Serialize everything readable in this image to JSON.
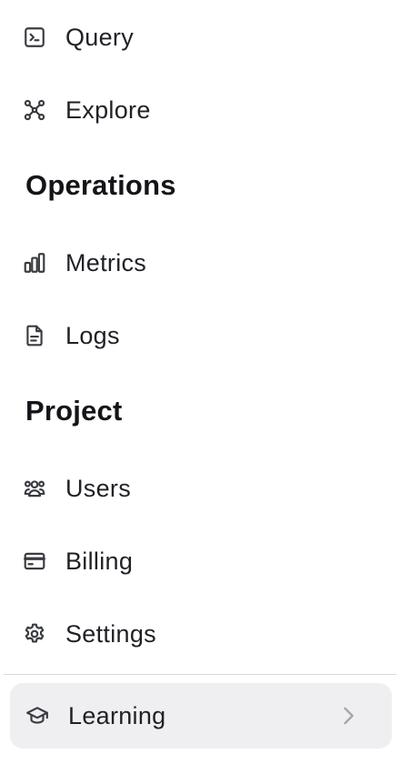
{
  "nav": {
    "items_top": [
      {
        "label": "Query",
        "icon": "terminal-icon"
      },
      {
        "label": "Explore",
        "icon": "graph-nodes-icon"
      }
    ],
    "sections": [
      {
        "heading": "Operations",
        "items": [
          {
            "label": "Metrics",
            "icon": "bar-chart-icon"
          },
          {
            "label": "Logs",
            "icon": "document-icon"
          }
        ]
      },
      {
        "heading": "Project",
        "items": [
          {
            "label": "Users",
            "icon": "users-icon"
          },
          {
            "label": "Billing",
            "icon": "credit-card-icon"
          },
          {
            "label": "Settings",
            "icon": "gear-icon"
          }
        ]
      }
    ],
    "footer_item": {
      "label": "Learning",
      "icon": "graduation-cap-icon",
      "chevron": "chevron-right-icon"
    }
  },
  "colors": {
    "text": "#1f2125",
    "heading": "#141518",
    "icon": "#3a3c42",
    "footer_bg": "#efeff1",
    "divider": "#d9d9dc",
    "chevron": "#a3a5ab"
  }
}
